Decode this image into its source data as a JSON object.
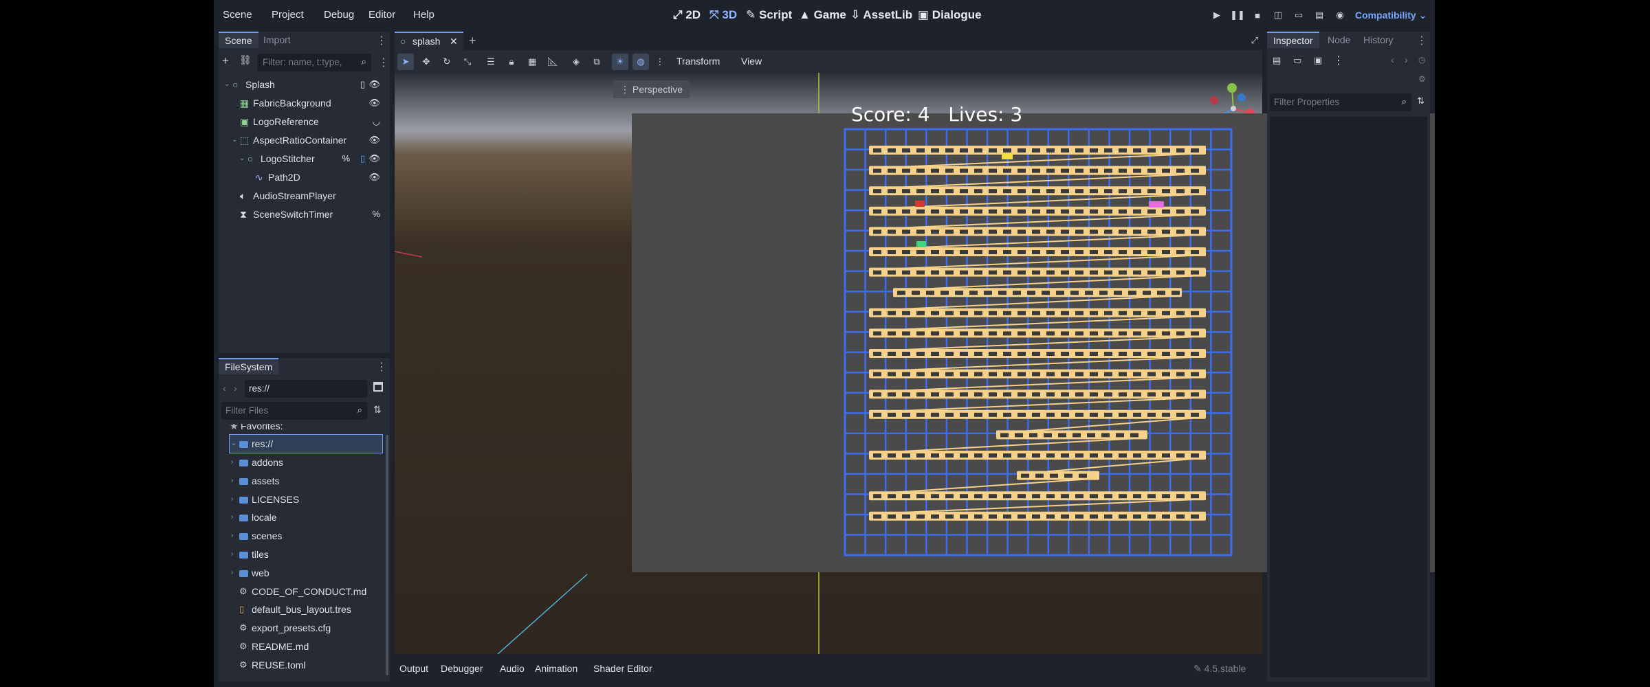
{
  "menu": [
    "Scene",
    "Project",
    "Debug",
    "Editor",
    "Help"
  ],
  "modes": [
    {
      "label": "2D",
      "icon": "2d-icon"
    },
    {
      "label": "3D",
      "icon": "3d-icon",
      "active": true
    },
    {
      "label": "Script",
      "icon": "script-icon"
    },
    {
      "label": "Game",
      "icon": "game-icon"
    },
    {
      "label": "AssetLib",
      "icon": "assetlib-icon"
    },
    {
      "label": "Dialogue",
      "icon": "dialogue-icon"
    }
  ],
  "renderer": "Compatibility",
  "scene_dock": {
    "tabs": [
      "Scene",
      "Import"
    ],
    "filter_placeholder": "Filter: name, t:type,",
    "nodes": [
      {
        "label": "Splash",
        "icon": "node-icon",
        "indent": 0,
        "expanded": true,
        "extras": [
          "script-icon",
          "visibility-icon"
        ]
      },
      {
        "label": "FabricBackground",
        "icon": "texturerect-icon",
        "indent": 1,
        "extras": [
          "visibility-icon"
        ]
      },
      {
        "label": "LogoReference",
        "icon": "sprite-icon",
        "indent": 1,
        "extras": [
          "hidden-icon"
        ]
      },
      {
        "label": "AspectRatioContainer",
        "icon": "container-icon",
        "indent": 1,
        "expanded": true,
        "extras": [
          "visibility-icon"
        ]
      },
      {
        "label": "LogoStitcher",
        "icon": "node-icon",
        "indent": 2,
        "expanded": true,
        "extras": [
          "unique-name-icon",
          "script-icon",
          "visibility-icon"
        ]
      },
      {
        "label": "Path2D",
        "icon": "path2d-icon",
        "indent": 3,
        "extras": [
          "visibility-icon"
        ]
      },
      {
        "label": "AudioStreamPlayer",
        "icon": "audio-icon",
        "indent": 1,
        "extras": []
      },
      {
        "label": "SceneSwitchTimer",
        "icon": "timer-icon",
        "indent": 1,
        "extras": [
          "unique-name-icon"
        ]
      }
    ]
  },
  "filesystem": {
    "title": "FileSystem",
    "path": "res://",
    "filter_placeholder": "Filter Files",
    "favorites": "Favorites:",
    "root": "res://",
    "items": [
      {
        "label": "addons",
        "type": "folder"
      },
      {
        "label": "assets",
        "type": "folder"
      },
      {
        "label": "LICENSES",
        "type": "folder"
      },
      {
        "label": "locale",
        "type": "folder"
      },
      {
        "label": "scenes",
        "type": "folder"
      },
      {
        "label": "tiles",
        "type": "folder"
      },
      {
        "label": "web",
        "type": "folder"
      },
      {
        "label": "CODE_OF_CONDUCT.md",
        "type": "file"
      },
      {
        "label": "default_bus_layout.tres",
        "type": "resource"
      },
      {
        "label": "export_presets.cfg",
        "type": "file"
      },
      {
        "label": "README.md",
        "type": "file"
      },
      {
        "label": "REUSE.toml",
        "type": "file"
      }
    ]
  },
  "editor_tab": "splash",
  "toolbar_menus": [
    "Transform",
    "View"
  ],
  "perspective": "Perspective",
  "game": {
    "score_text": "Score: 4   Lives: 3"
  },
  "inspector": {
    "tabs": [
      "Inspector",
      "Node",
      "History"
    ],
    "filter_placeholder": "Filter Properties"
  },
  "bottom_tabs": [
    "Output",
    "Debugger",
    "Audio",
    "Animation",
    "Shader Editor"
  ],
  "version": "4.5.stable",
  "colors": {
    "accent": "#6f9ef7",
    "grid": "#3d6cf0",
    "stripe": "#f5d18a",
    "stage": "#4a4a4a"
  }
}
